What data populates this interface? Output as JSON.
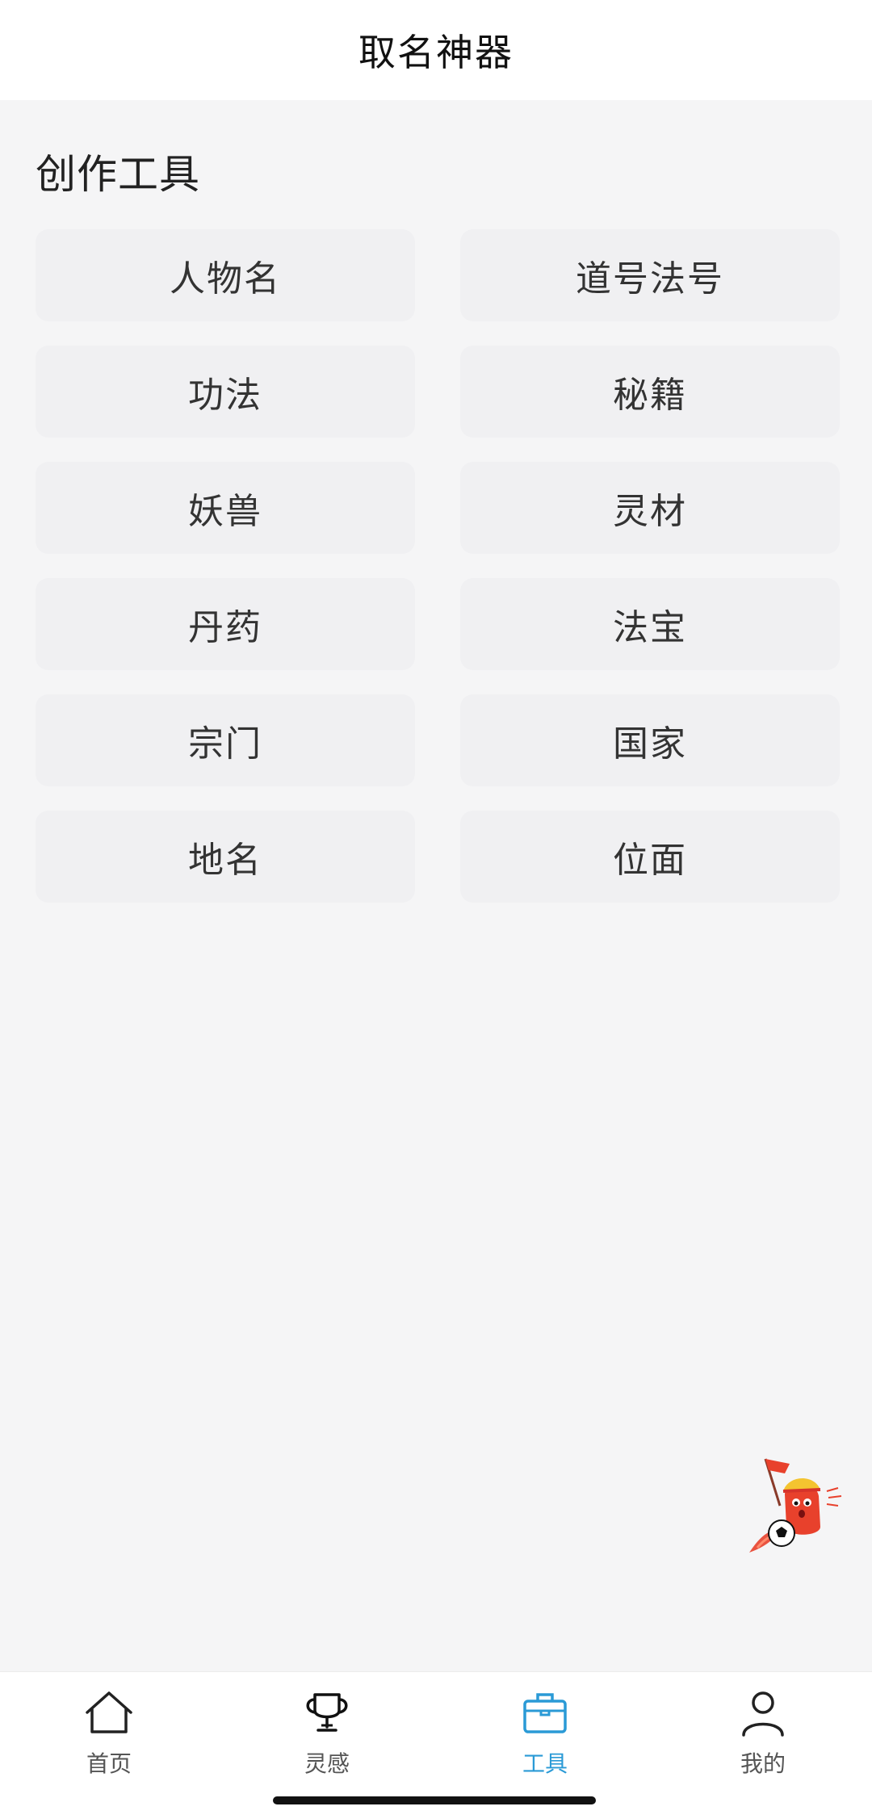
{
  "header": {
    "title": "取名神器"
  },
  "section": {
    "title": "创作工具"
  },
  "tools": [
    {
      "label": "人物名"
    },
    {
      "label": "道号法号"
    },
    {
      "label": "功法"
    },
    {
      "label": "秘籍"
    },
    {
      "label": "妖兽"
    },
    {
      "label": "灵材"
    },
    {
      "label": "丹药"
    },
    {
      "label": "法宝"
    },
    {
      "label": "宗门"
    },
    {
      "label": "国家"
    },
    {
      "label": "地名"
    },
    {
      "label": "位面"
    }
  ],
  "tabbar": {
    "items": [
      {
        "label": "首页",
        "icon": "home-icon"
      },
      {
        "label": "灵感",
        "icon": "trophy-icon"
      },
      {
        "label": "工具",
        "icon": "toolbox-icon",
        "active": true
      },
      {
        "label": "我的",
        "icon": "user-icon"
      }
    ],
    "active_color": "#2a9ad6"
  }
}
